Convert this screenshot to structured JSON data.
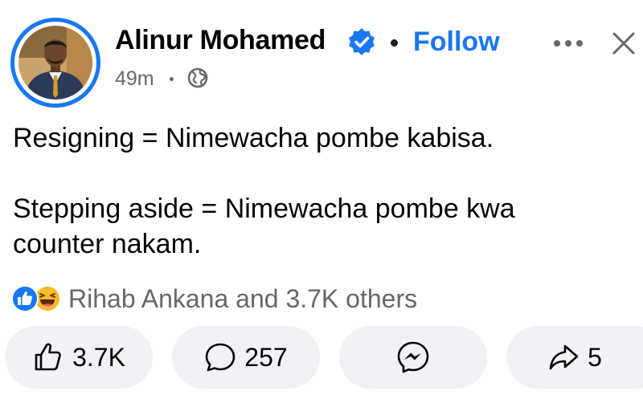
{
  "post": {
    "author": {
      "name": "Alinur Mohamed",
      "verified_icon": "verified-badge-icon",
      "avatar_icon": "profile-photo"
    },
    "follow_label": "Follow",
    "timestamp": "49m",
    "audience_icon": "globe-icon",
    "text_lines": [
      "Resigning = Nimewacha pombe kabisa.",
      "Stepping aside = Nimewacha pombe kwa",
      "counter nakam."
    ],
    "reactions": {
      "icons": [
        "like-reaction-icon",
        "haha-reaction-icon"
      ],
      "summary": "Rihab Ankana and 3.7K others"
    },
    "actions": {
      "like_count": "3.7K",
      "comment_count": "257",
      "share_count": "5"
    }
  },
  "colors": {
    "brand_blue": "#1877f2",
    "text_primary": "#050505",
    "text_secondary": "#65676b",
    "button_bg": "#f0f2f5",
    "haha_yellow": "#f7b928"
  }
}
